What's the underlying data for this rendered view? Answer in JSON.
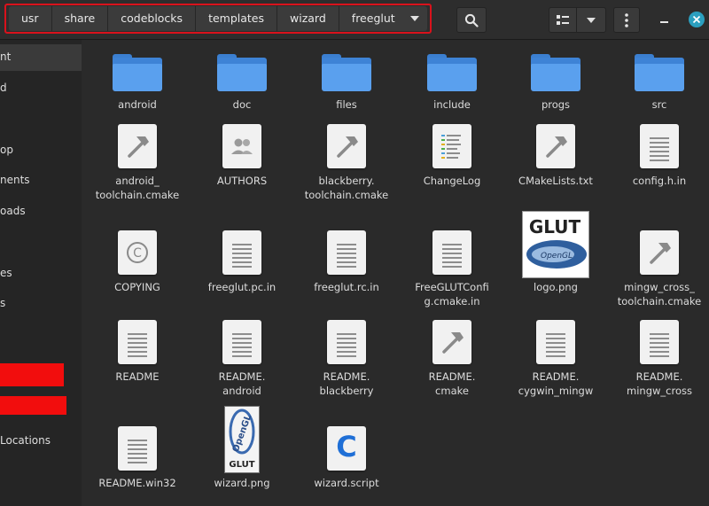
{
  "path_bar": {
    "crumbs": [
      "usr",
      "share",
      "codeblocks",
      "templates",
      "wizard",
      "freeglut"
    ],
    "dropdown_icon": "chevron-down-icon"
  },
  "header": {
    "search_icon": "search-icon",
    "view_icon": "list-view-icon",
    "view_menu_icon": "chevron-down-icon",
    "menu_icon": "kebab-menu-icon",
    "minimize_icon": "minimize-icon",
    "close_icon": "close-icon"
  },
  "sidebar": {
    "items": [
      "nt",
      "d",
      "op",
      "nents",
      "oads",
      "es",
      "s",
      "Locations"
    ]
  },
  "files": [
    {
      "name": "android",
      "kind": "folder"
    },
    {
      "name": "doc",
      "kind": "folder"
    },
    {
      "name": "files",
      "kind": "folder"
    },
    {
      "name": "include",
      "kind": "folder"
    },
    {
      "name": "progs",
      "kind": "folder"
    },
    {
      "name": "src",
      "kind": "folder"
    },
    {
      "name": "android_\ntoolchain.cmake",
      "kind": "cmake"
    },
    {
      "name": "AUTHORS",
      "kind": "authors"
    },
    {
      "name": "blackberry.\ntoolchain.cmake",
      "kind": "cmake"
    },
    {
      "name": "ChangeLog",
      "kind": "changelog"
    },
    {
      "name": "CMakeLists.txt",
      "kind": "cmake"
    },
    {
      "name": "config.h.in",
      "kind": "text"
    },
    {
      "name": "COPYING",
      "kind": "copyright"
    },
    {
      "name": "freeglut.pc.in",
      "kind": "text"
    },
    {
      "name": "freeglut.rc.in",
      "kind": "text"
    },
    {
      "name": "FreeGLUTConfi\ng.cmake.in",
      "kind": "text"
    },
    {
      "name": "logo.png",
      "kind": "image",
      "image_text": "GLUT"
    },
    {
      "name": "mingw_cross_\ntoolchain.cmake",
      "kind": "cmake"
    },
    {
      "name": "README",
      "kind": "text"
    },
    {
      "name": "README.\nandroid",
      "kind": "text"
    },
    {
      "name": "README.\nblackberry",
      "kind": "text"
    },
    {
      "name": "README.\ncmake",
      "kind": "cmake"
    },
    {
      "name": "README.\ncygwin_mingw",
      "kind": "text"
    },
    {
      "name": "README.\nmingw_cross",
      "kind": "text"
    },
    {
      "name": "README.win32",
      "kind": "text"
    },
    {
      "name": "wizard.png",
      "kind": "image",
      "image_text": "OpenGL GLUT"
    },
    {
      "name": "wizard.script",
      "kind": "script",
      "glyph": "C"
    }
  ],
  "colors": {
    "accent_red": "#d9121c",
    "folder_blue": "#5aa0ee",
    "close_button": "#2b9fbf"
  }
}
